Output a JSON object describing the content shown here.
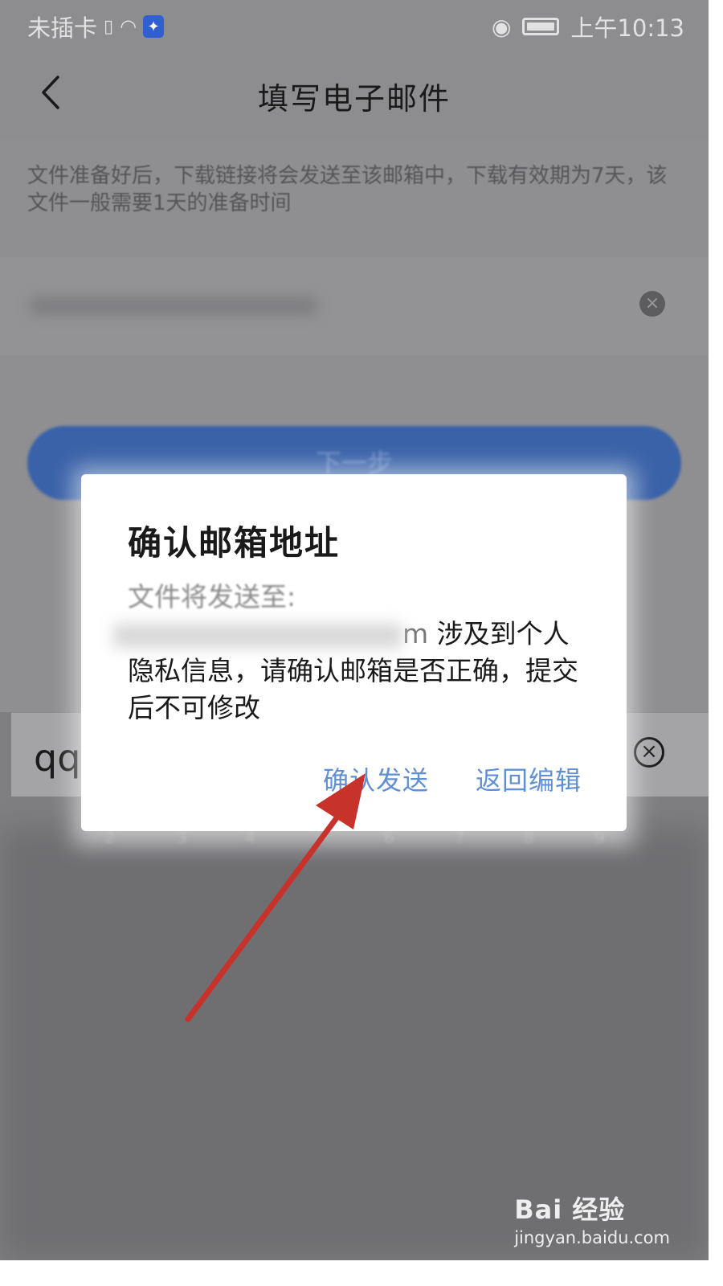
{
  "status_bar": {
    "carrier": "未插卡",
    "time": "上午10:13"
  },
  "header": {
    "title": "填写电子邮件"
  },
  "description": "文件准备好后，下载链接将会发送至该邮箱中，下载有效期为7天，该文件一般需要1天的准备时间",
  "next_button_label": "下一步",
  "input": {
    "value": "qq"
  },
  "keyboard_hints": [
    "2",
    "3",
    "4",
    "6",
    "7",
    "8",
    "9"
  ],
  "dialog": {
    "title": "确认邮箱地址",
    "message_prefix": "文件将发送至:",
    "message_partial_email": "m",
    "message_suffix": "涉及到个人隐私信息，请确认邮箱是否正确，提交后不可修改",
    "confirm_label": "确认发送",
    "back_label": "返回编辑"
  },
  "watermark": {
    "brand": "Bai 经验",
    "url": "jingyan.baidu.com"
  },
  "colors": {
    "accent": "#5f8fd6",
    "arrow": "#c7322b",
    "primary_button": "#3a62a8"
  }
}
